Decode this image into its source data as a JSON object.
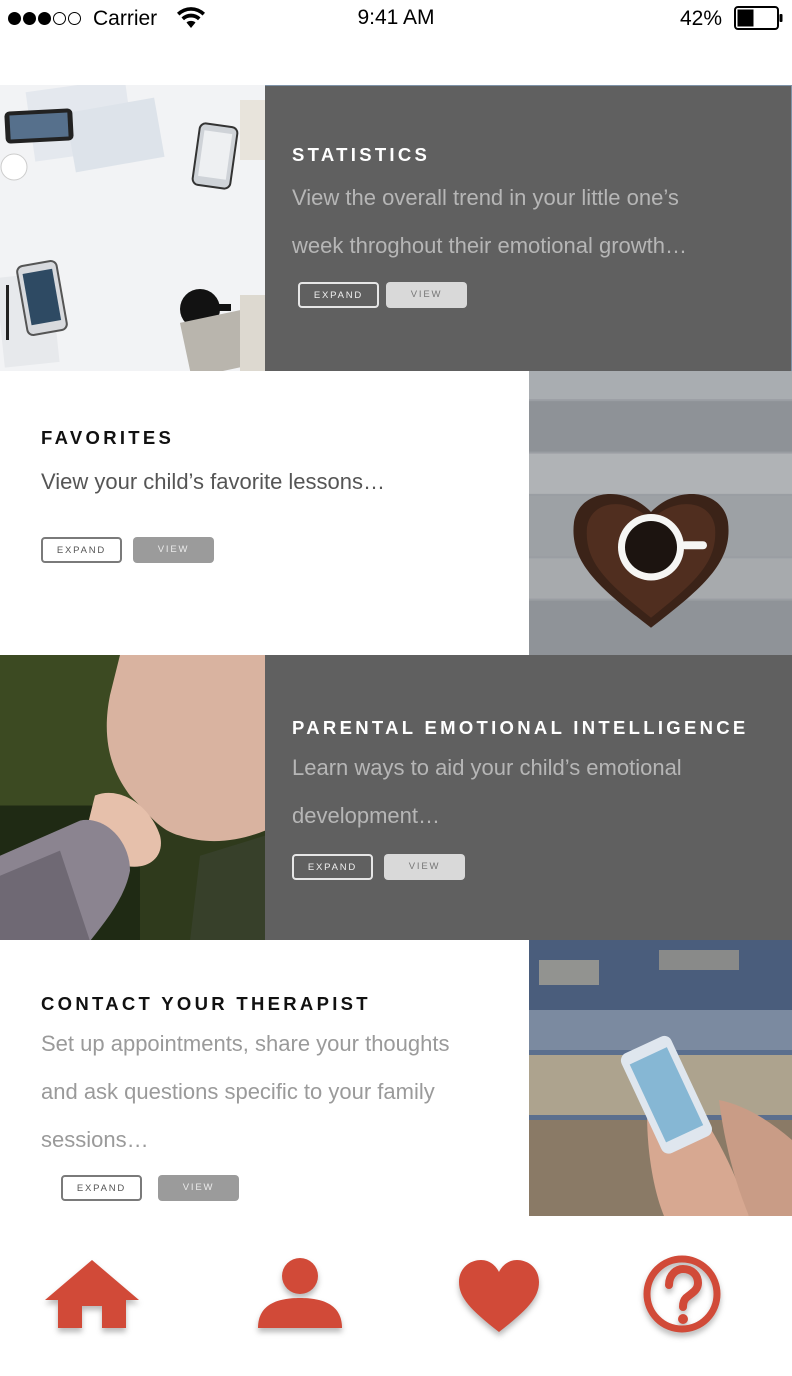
{
  "status_bar": {
    "carrier": "Carrier",
    "time": "9:41 AM",
    "battery_percent": "42%",
    "battery_level": 0.42
  },
  "cards": [
    {
      "title": "STATISTICS",
      "description_lines": [
        "View the overall trend in your little one’s",
        "week throghout their emotional growth…"
      ],
      "expand_label": "EXPAND",
      "view_label": "VIEW"
    },
    {
      "title": "FAVORITES",
      "description_lines": [
        "View your child’s favorite lessons…"
      ],
      "expand_label": "EXPAND",
      "view_label": "VIEW"
    },
    {
      "title": "PARENTAL EMOTIONAL INTELLIGENCE",
      "description_lines": [
        "Learn ways to aid your child’s emotional",
        "development…"
      ],
      "expand_label": "EXPAND",
      "view_label": "VIEW"
    },
    {
      "title": "CONTACT YOUR THERAPIST",
      "description_lines": [
        "Set up appointments, share your thoughts",
        "and ask questions specific to your family",
        "sessions…"
      ],
      "expand_label": "EXPAND",
      "view_label": "VIEW"
    }
  ],
  "tab_bar": {
    "tabs": [
      "home-icon",
      "profile-icon",
      "heart-icon",
      "help-icon"
    ],
    "accent_color": "#d14a38"
  },
  "colors": {
    "dark_panel": "#606060",
    "light_panel": "#ffffff"
  }
}
